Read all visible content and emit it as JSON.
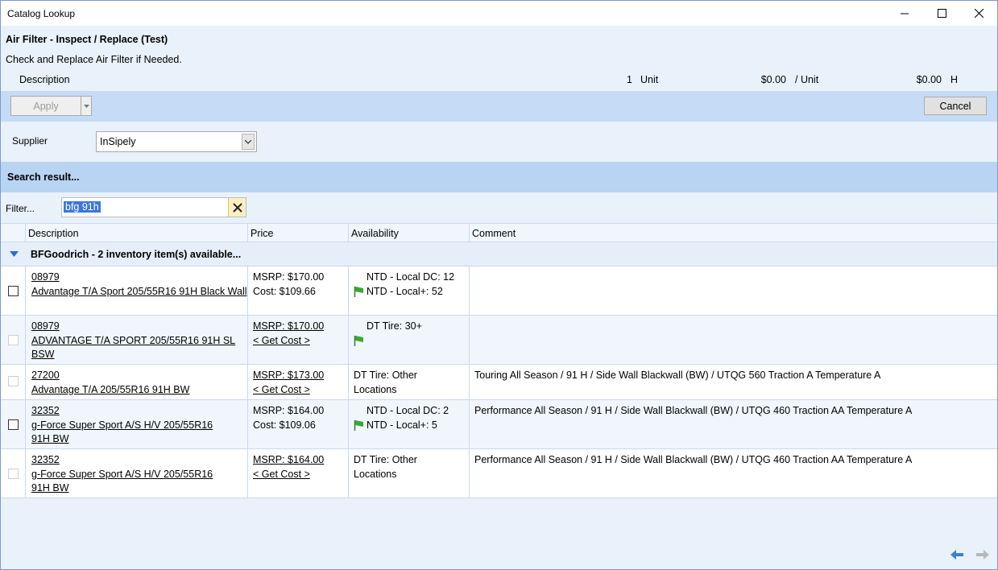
{
  "window": {
    "title": "Catalog Lookup"
  },
  "operation": {
    "title": "Air Filter - Inspect / Replace (Test)",
    "description": "Check and Replace Air Filter if Needed.",
    "line": {
      "description": "Description",
      "quantity": "1",
      "unit": "Unit",
      "price": "$0.00",
      "per_unit": "/ Unit",
      "total": "$0.00",
      "hours": "H"
    }
  },
  "toolbar": {
    "apply_label": "Apply",
    "cancel_label": "Cancel"
  },
  "supplier": {
    "label": "Supplier",
    "value": "InSipely"
  },
  "search": {
    "header": "Search result..."
  },
  "filter": {
    "label": "Filter...",
    "value": "bfg 91h"
  },
  "grid": {
    "columns": [
      "Description",
      "Price",
      "Availability",
      "Comment"
    ],
    "group": "BFGoodrich - 2 inventory item(s) available...",
    "rows": [
      {
        "checkbox_enabled": true,
        "code": "08979",
        "name": "Advantage T/A Sport 205/55R16 91H Black Wall",
        "msrp": "MSRP: $170.00",
        "cost": "Cost: $109.66",
        "msrp_link": false,
        "availability": [
          "NTD - Local DC: 12",
          "NTD - Local+: 52"
        ],
        "comment": ""
      },
      {
        "checkbox_enabled": false,
        "code": "08979",
        "name": "ADVANTAGE T/A SPORT 205/55R16 91H SL BSW",
        "msrp": "MSRP: $170.00",
        "cost": "< Get Cost >",
        "msrp_link": true,
        "availability": [
          "DT Tire: 30+"
        ],
        "comment": ""
      },
      {
        "checkbox_enabled": false,
        "code": "27200",
        "name": "Advantage T/A 205/55R16 91H BW",
        "msrp": "MSRP: $173.00",
        "cost": "< Get Cost >",
        "msrp_link": true,
        "availability": [
          "DT Tire: Other Locations"
        ],
        "comment": "Touring All Season / 91 H / Side Wall Blackwall (BW) / UTQG 560 Traction A Temperature A"
      },
      {
        "checkbox_enabled": true,
        "code": "32352",
        "name": "g-Force Super Sport A/S H/V 205/55R16 91H BW",
        "msrp": "MSRP: $164.00",
        "cost": "Cost: $109.06",
        "msrp_link": false,
        "availability": [
          "NTD - Local DC: 2",
          "NTD - Local+: 5"
        ],
        "comment": "Performance All Season / 91 H / Side Wall Blackwall (BW) / UTQG 460 Traction AA Temperature A"
      },
      {
        "checkbox_enabled": false,
        "code": "32352",
        "name": "g-Force Super Sport A/S H/V 205/55R16 91H BW",
        "msrp": "MSRP: $164.00",
        "cost": "< Get Cost >",
        "msrp_link": true,
        "availability": [
          "DT Tire: Other Locations"
        ],
        "comment": "Performance All Season / 91 H / Side Wall Blackwall (BW) / UTQG 460 Traction AA Temperature A"
      }
    ]
  },
  "colors": {
    "accent": "#c5dbf6",
    "search_header": "#b9d3f2",
    "flag": "#3aa832",
    "nav_arrow": "#3d7fd6"
  },
  "icons": [
    "minimize-icon",
    "maximize-icon",
    "close-icon",
    "dropdown-arrow-icon",
    "clear-filter-icon",
    "collapse-group-icon",
    "flag-icon",
    "prev-arrow-icon",
    "next-arrow-icon"
  ]
}
